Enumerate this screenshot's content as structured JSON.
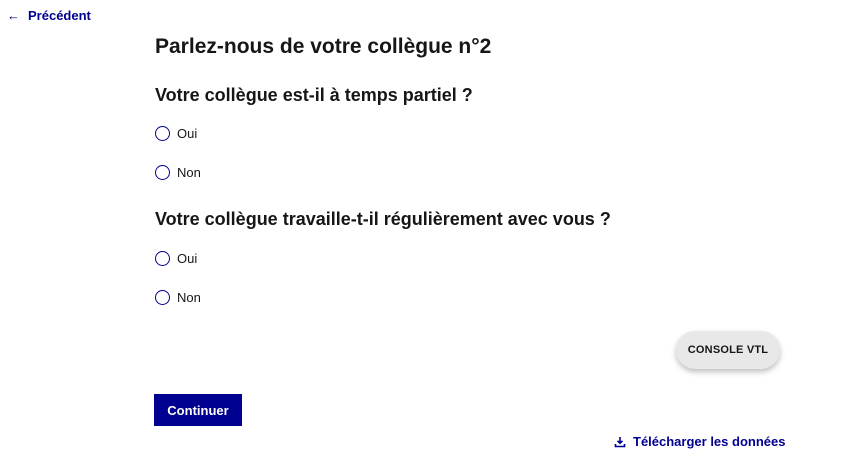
{
  "nav": {
    "back_label": "Précédent",
    "back_icon": "arrow-left-icon"
  },
  "page": {
    "title": "Parlez-nous de votre collègue n°2"
  },
  "questions": [
    {
      "label": "Votre collègue est-il à temps partiel ?",
      "options": [
        {
          "label": "Oui",
          "selected": false
        },
        {
          "label": "Non",
          "selected": false
        }
      ]
    },
    {
      "label": "Votre collègue travaille-t-il régulièrement avec vous ?",
      "options": [
        {
          "label": "Oui",
          "selected": false
        },
        {
          "label": "Non",
          "selected": false
        }
      ]
    }
  ],
  "actions": {
    "console_label": "CONSOLE VTL",
    "continue_label": "Continuer",
    "download_label": "Télécharger les données",
    "download_icon": "download-icon"
  },
  "colors": {
    "primary": "#000091",
    "text": "#161616",
    "console_bg": "#e8e8e8"
  }
}
